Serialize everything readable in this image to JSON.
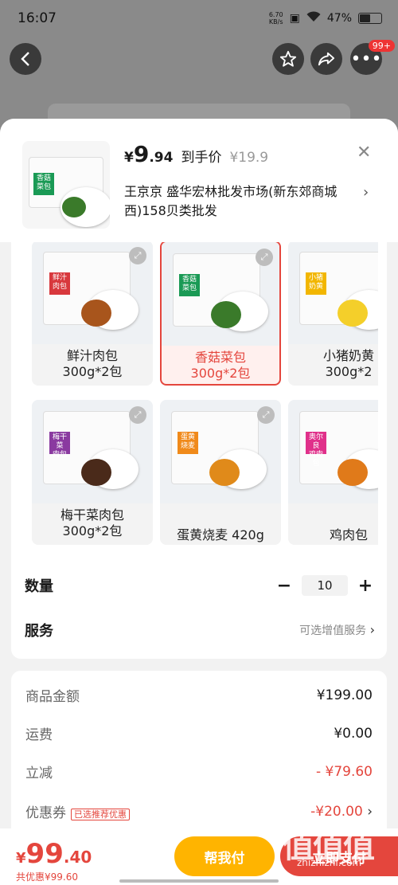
{
  "status": {
    "time": "16:07",
    "net_speed_line1": "6.70",
    "net_speed_line2": "KB/s",
    "battery": "47%"
  },
  "topbar": {
    "more_badge": "99+"
  },
  "header": {
    "yen": "¥",
    "price_int": "9",
    "price_dec": ".94",
    "daoshou": "到手价",
    "original_price": "¥19.9",
    "shop_name": "王京京  盛华宏林批发市场(新东郊商城西)158贝类批发"
  },
  "variants": [
    {
      "name": "鲜汁肉包",
      "spec": "300g*2包",
      "label": "鲜汁\n肉包",
      "label_color": "#d8383d",
      "filling_color": "#a8551c",
      "selected": false
    },
    {
      "name": "香菇菜包",
      "spec": "300g*2包",
      "label": "香菇\n菜包",
      "label_color": "#1a9a55",
      "filling_color": "#3a7a2a",
      "selected": true
    },
    {
      "name": "小猪奶黄",
      "spec": "300g*2",
      "label": "小猪\n奶黄",
      "label_color": "#f2b600",
      "filling_color": "#f4cf2a",
      "selected": false
    },
    {
      "name": "梅干菜肉包",
      "spec": "300g*2包",
      "label": "梅干菜\n肉包",
      "label_color": "#8a3aa0",
      "filling_color": "#4a2a1a",
      "selected": false
    },
    {
      "name": "蛋黄烧麦 420g",
      "spec": "",
      "label": "蛋黄\n烧麦",
      "label_color": "#f08a1a",
      "filling_color": "#e08a1a",
      "selected": false
    },
    {
      "name": "鸡肉包",
      "spec": "",
      "label": "奥尔良\n鸡肉包",
      "label_color": "#e0308a",
      "filling_color": "#e07a1a",
      "selected": false
    }
  ],
  "quantity": {
    "label": "数量",
    "value": "10",
    "minus": "−",
    "plus": "+"
  },
  "service": {
    "label": "服务",
    "hint": "可选增值服务"
  },
  "breakdown": {
    "goods": {
      "label": "商品金额",
      "value": "¥199.00"
    },
    "shipping": {
      "label": "运费",
      "value": "¥0.00"
    },
    "discount": {
      "label": "立减",
      "value": "- ¥79.60"
    },
    "coupon": {
      "label": "优惠券",
      "tag": "已选推荐优惠",
      "value": "-¥20.00"
    }
  },
  "footer": {
    "total_yen": "¥",
    "total_int": "99",
    "total_dec": ".40",
    "saved": "共优惠¥99.60",
    "help_pay": "帮我付",
    "pay": "立即支付"
  },
  "watermark": {
    "text": "值值值",
    "url": "zhizhizhi.com"
  },
  "colors": {
    "accent": "#e4463d",
    "help_btn": "#ffb400"
  }
}
